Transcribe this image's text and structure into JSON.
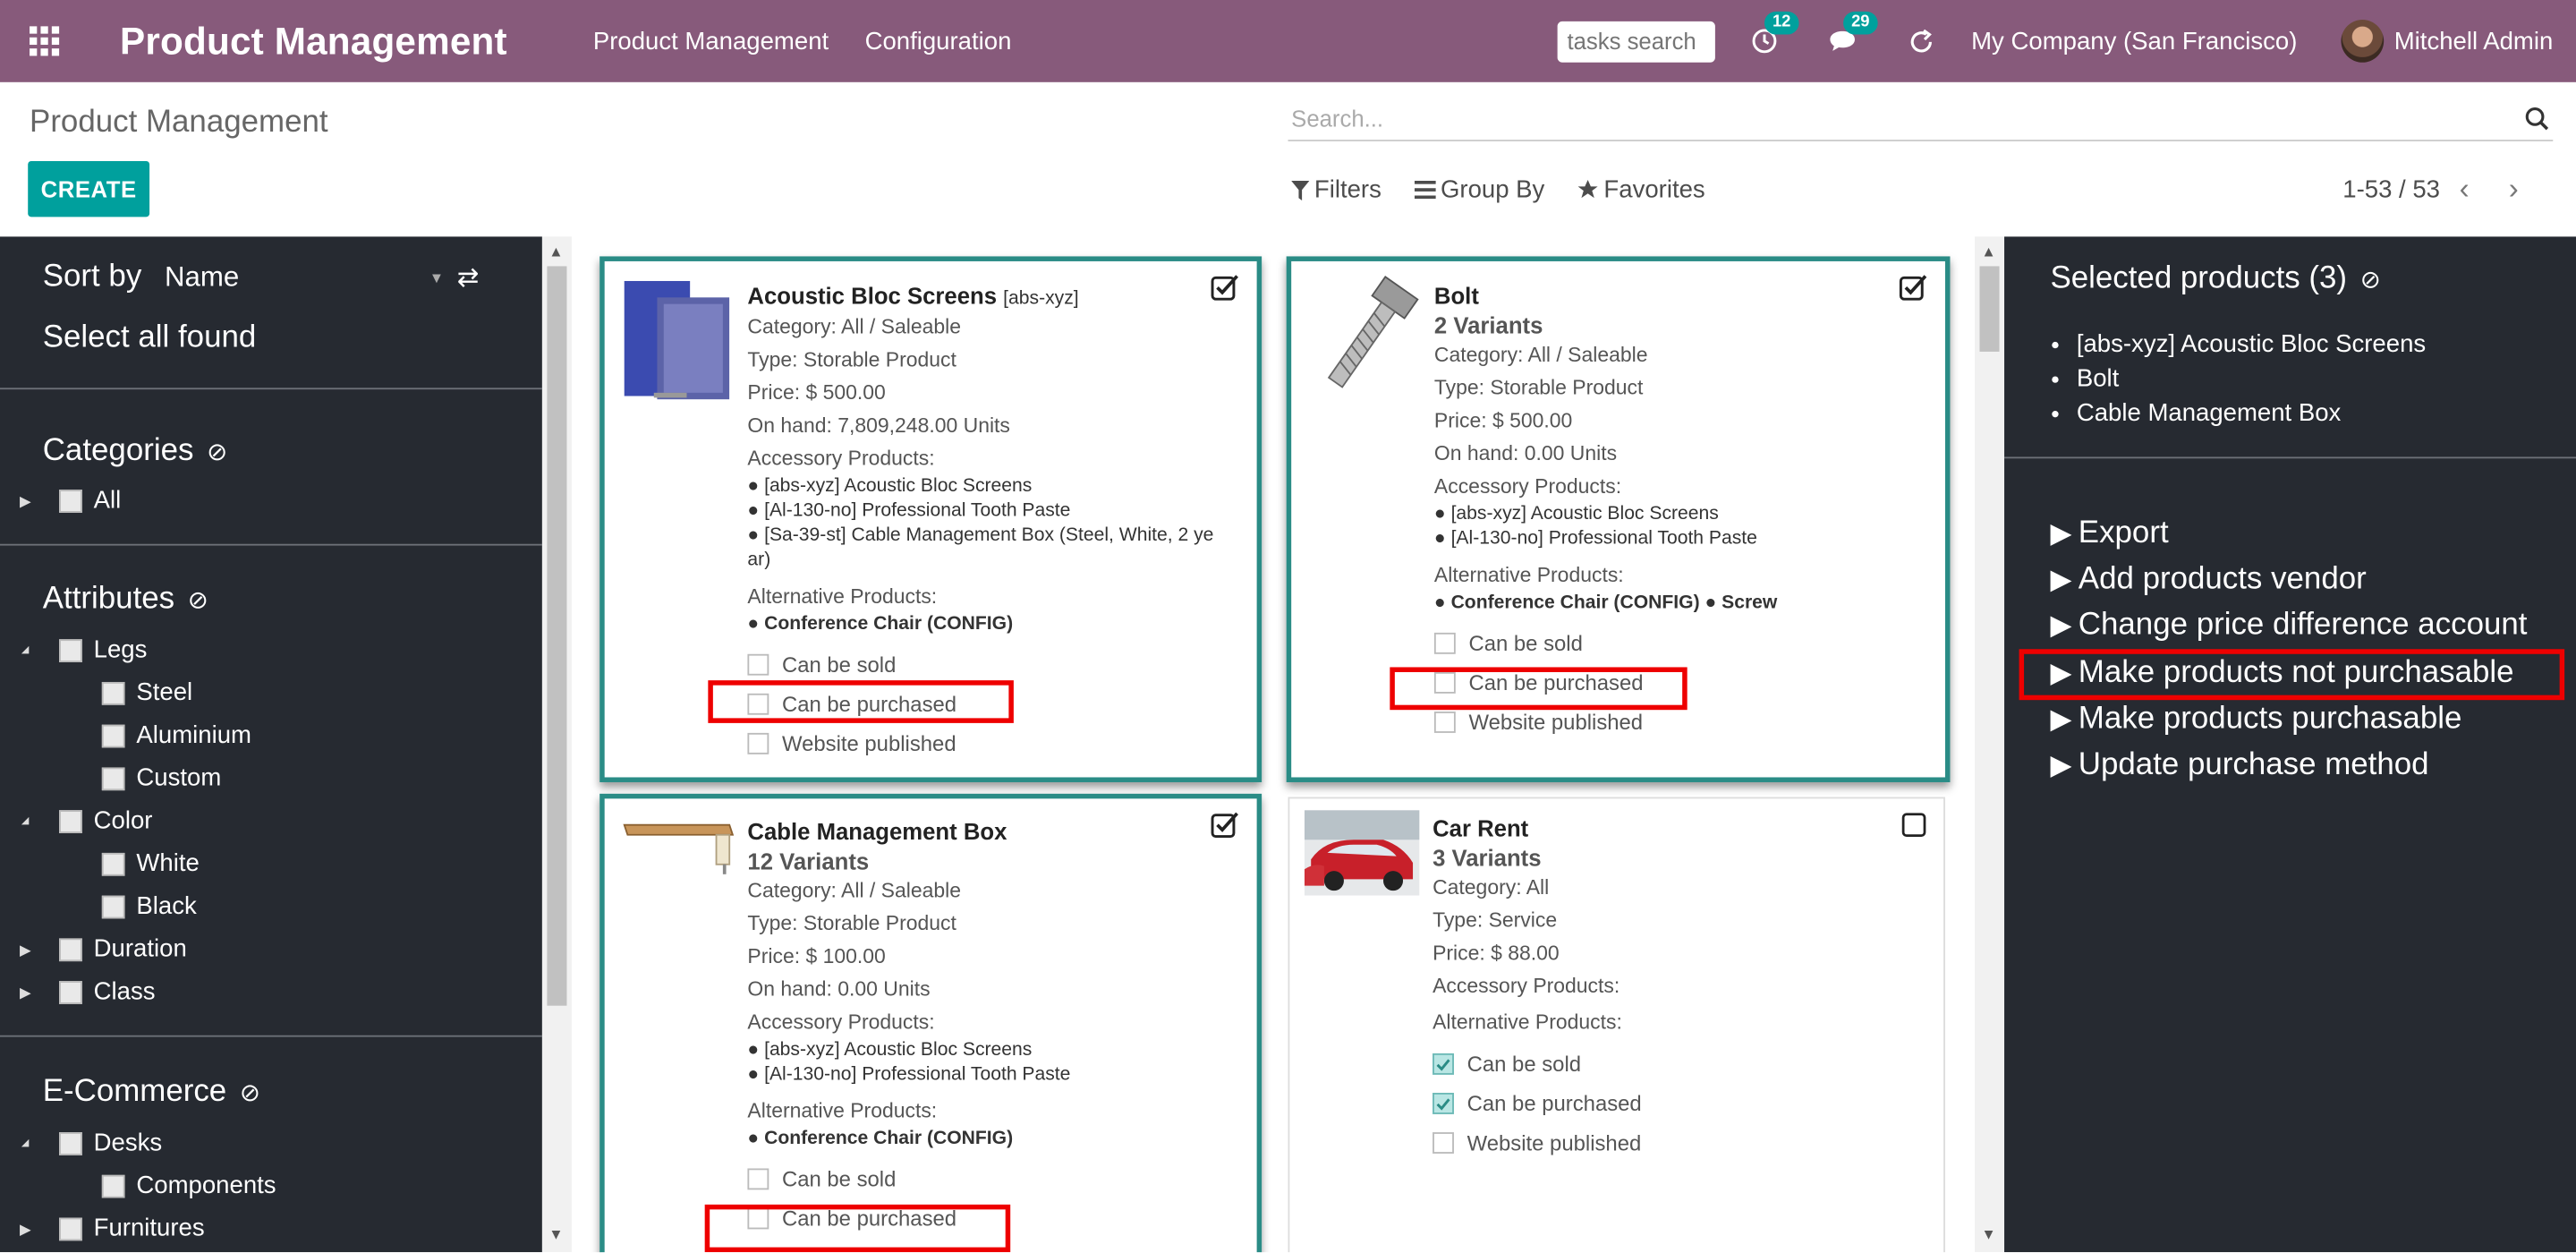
{
  "navbar": {
    "brand": "Product Management",
    "menu": [
      "Product Management",
      "Configuration"
    ],
    "tasks_search_placeholder": "tasks search",
    "activity_badge": "12",
    "messages_badge": "29",
    "company": "My Company (San Francisco)",
    "user": "Mitchell Admin"
  },
  "control_panel": {
    "title": "Product Management",
    "create_label": "CREATE",
    "search_placeholder": "Search...",
    "filters_label": "Filters",
    "group_by_label": "Group By",
    "favorites_label": "Favorites",
    "pager": "1-53 / 53"
  },
  "sidebar": {
    "sort_label": "Sort by",
    "sort_value": "Name",
    "select_all": "Select all found",
    "categories_title": "Categories",
    "categories": [
      "All"
    ],
    "attributes_title": "Attributes",
    "legs": "Legs",
    "legs_values": [
      "Steel",
      "Aluminium",
      "Custom"
    ],
    "color": "Color",
    "color_values": [
      "White",
      "Black"
    ],
    "duration": "Duration",
    "class": "Class",
    "ecommerce_title": "E-Commerce",
    "desks": "Desks",
    "components": "Components",
    "furnitures": "Furnitures"
  },
  "cards": [
    {
      "name": "Acoustic Bloc Screens",
      "code": "[abs-xyz]",
      "category": "Category: All / Saleable",
      "type": "Type: Storable Product",
      "price": "Price: $ 500.00",
      "on_hand": "On hand: 7,809,248.00 Units",
      "accessory_label": "Accessory Products:",
      "accessories": [
        "[abs-xyz] Acoustic Bloc Screens",
        "[Al-130-no] Professional Tooth Paste",
        "[Sa-39-st] Cable Management Box (Steel, White, 2 ye",
        "ar)"
      ],
      "alternative_label": "Alternative Products:",
      "alternatives": "Conference Chair (CONFIG)",
      "can_be_sold": "Can be sold",
      "can_be_purchased": "Can be purchased",
      "website_published": "Website published",
      "selected": true
    },
    {
      "name": "Bolt",
      "variants": "2 Variants",
      "category": "Category: All / Saleable",
      "type": "Type: Storable Product",
      "price": "Price: $ 500.00",
      "on_hand": "On hand: 0.00 Units",
      "accessory_label": "Accessory Products:",
      "accessories": [
        "[abs-xyz] Acoustic Bloc Screens",
        "[Al-130-no] Professional Tooth Paste"
      ],
      "alternative_label": "Alternative Products:",
      "alternatives_a": "Conference Chair (CONFIG)",
      "alternatives_b": "Screw",
      "can_be_sold": "Can be sold",
      "can_be_purchased": "Can be purchased",
      "website_published": "Website published",
      "selected": true
    },
    {
      "name": "Cable Management Box",
      "variants": "12 Variants",
      "category": "Category: All / Saleable",
      "type": "Type: Storable Product",
      "price": "Price: $ 100.00",
      "on_hand": "On hand: 0.00 Units",
      "accessory_label": "Accessory Products:",
      "accessories": [
        "[abs-xyz] Acoustic Bloc Screens",
        "[Al-130-no] Professional Tooth Paste"
      ],
      "alternative_label": "Alternative Products:",
      "alternatives": "Conference Chair (CONFIG)",
      "can_be_sold": "Can be sold",
      "can_be_purchased": "Can be purchased",
      "selected": true
    },
    {
      "name": "Car Rent",
      "variants": "3 Variants",
      "category": "Category: All",
      "type": "Type: Service",
      "price": "Price: $ 88.00",
      "accessory_label": "Accessory Products:",
      "alternative_label": "Alternative Products:",
      "can_be_sold": "Can be sold",
      "can_be_purchased": "Can be purchased",
      "website_published": "Website published",
      "selected": false
    }
  ],
  "right_panel": {
    "title": "Selected products (3)",
    "selected": [
      "[abs-xyz] Acoustic Bloc Screens",
      "Bolt",
      "Cable Management Box"
    ],
    "actions": [
      "Export",
      "Add products vendor",
      "Change price difference account",
      "Make products not purchasable",
      "Make products purchasable",
      "Update purchase method"
    ]
  },
  "colors": {
    "navbar": "#875a7b",
    "primary": "#00a09d",
    "dark_panel": "#262a31",
    "highlight": "#e00000"
  }
}
